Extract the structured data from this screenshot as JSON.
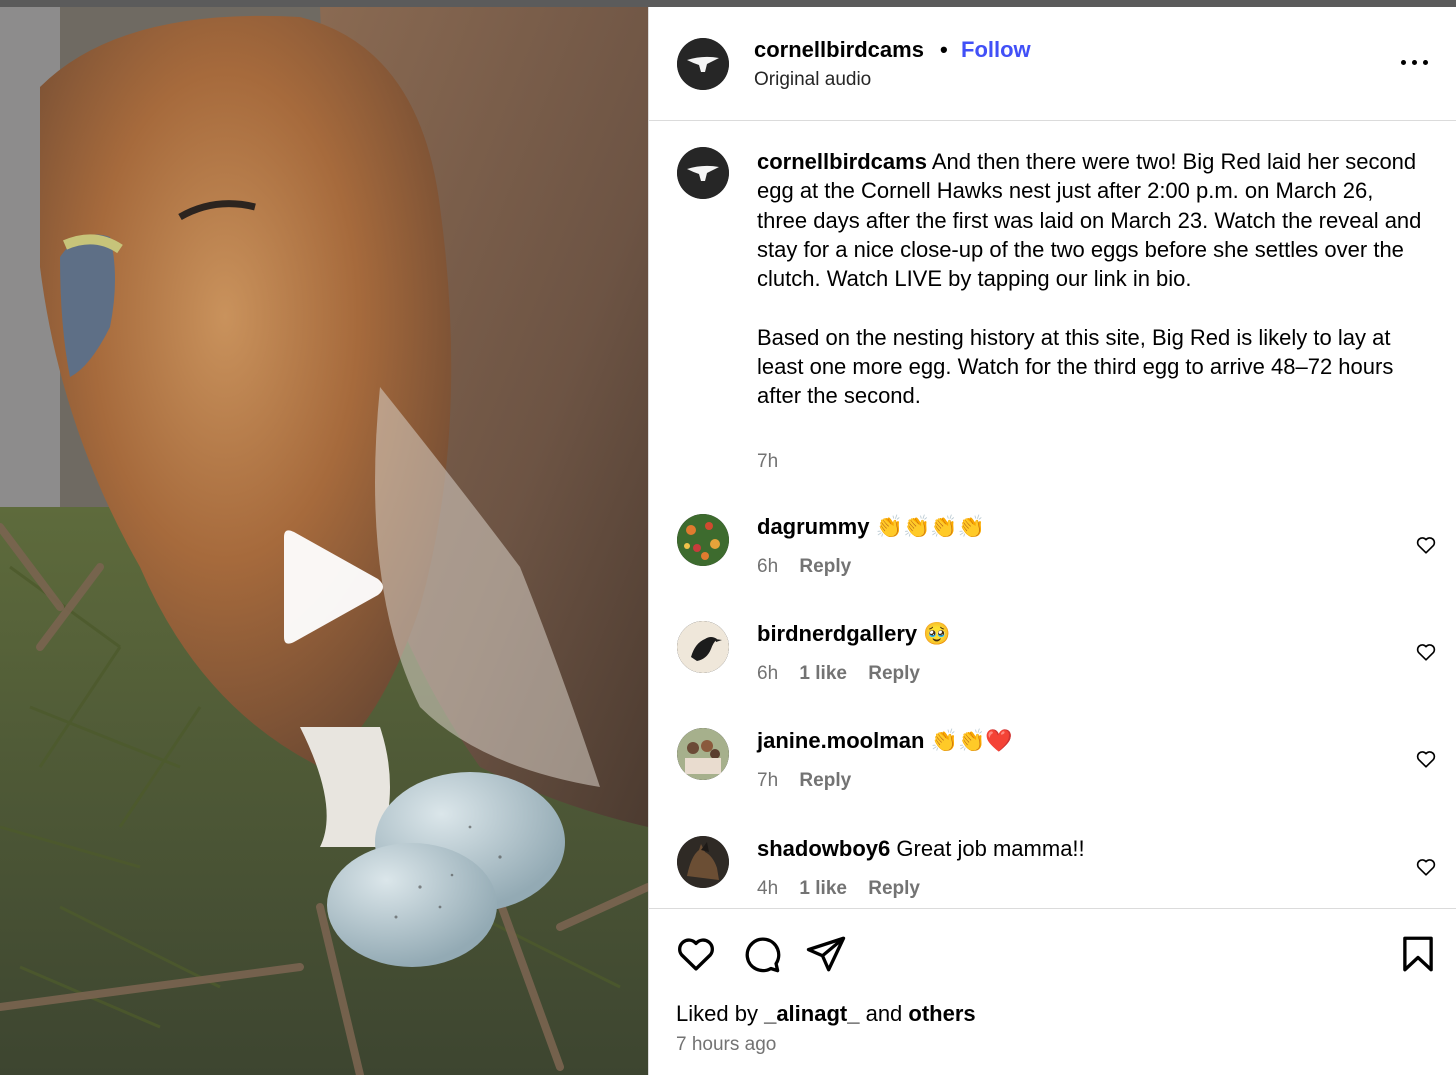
{
  "post": {
    "username": "cornellbirdcams",
    "follow_label": "Follow",
    "audio": "Original audio",
    "more_label": "More options"
  },
  "caption": {
    "username": "cornellbirdcams",
    "text1": "And then there were two! Big Red laid her second egg at the Cornell Hawks nest just after 2:00 p.m. on March 26, three days after the first was laid on March 23. Watch the reveal and stay for a nice close-up of the two eggs before she settles over the clutch. Watch LIVE by tapping our link in bio.",
    "text2": "Based on the nesting history at this site, Big Red is likely to lay at least one more egg. Watch for the third egg to arrive 48–72 hours after the second.",
    "time": "7h"
  },
  "comments": [
    {
      "username": "dagrummy",
      "text": "👏👏👏👏",
      "time": "6h",
      "likes": "",
      "reply": "Reply"
    },
    {
      "username": "birdnerdgallery",
      "text": "🥹",
      "time": "6h",
      "likes": "1 like",
      "reply": "Reply"
    },
    {
      "username": "janine.moolman",
      "text": "👏👏❤️",
      "time": "7h",
      "likes": "",
      "reply": "Reply"
    },
    {
      "username": "shadowboy6",
      "text": "Great job mamma!!",
      "time": "4h",
      "likes": "1 like",
      "reply": "Reply"
    }
  ],
  "footer": {
    "liked_prefix": "Liked by",
    "liked_user": "_alinagt_",
    "liked_and": "and",
    "liked_others": "others",
    "time_ago": "7 hours ago"
  },
  "icons": {
    "like": "heart-icon",
    "comment": "comment-icon",
    "share": "share-icon",
    "save": "bookmark-icon",
    "play": "play-icon"
  },
  "colors": {
    "follow": "#4150f7",
    "secondary_text": "#737373",
    "divider": "#dbdbdb"
  }
}
